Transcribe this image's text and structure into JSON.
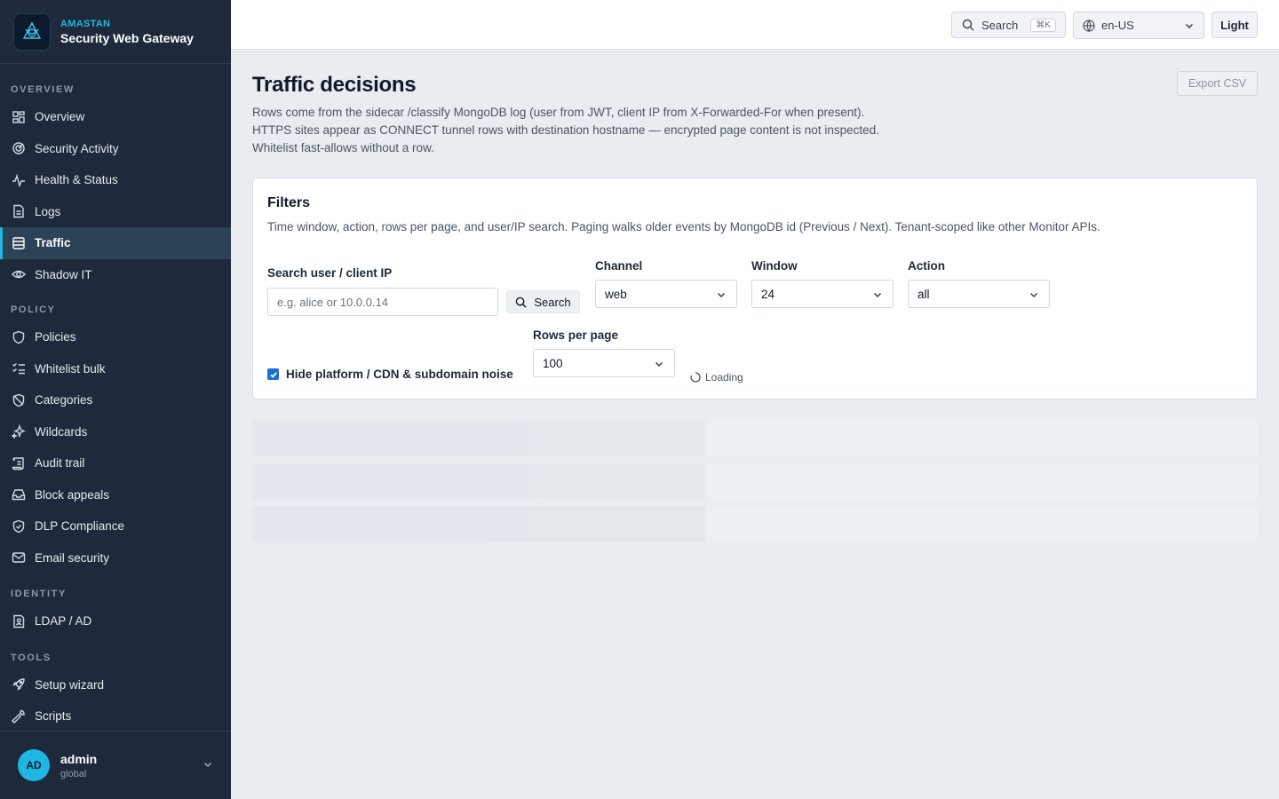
{
  "brand": {
    "company": "AMASTAN",
    "product": "Security Web Gateway"
  },
  "sidebar": {
    "sections": [
      {
        "label": "OVERVIEW",
        "items": [
          {
            "label": "Overview",
            "icon": "grid-icon"
          },
          {
            "label": "Security Activity",
            "icon": "radar-icon"
          },
          {
            "label": "Health & Status",
            "icon": "pulse-icon"
          },
          {
            "label": "Logs",
            "icon": "document-icon"
          },
          {
            "label": "Traffic",
            "icon": "list-icon",
            "active": true
          },
          {
            "label": "Shadow IT",
            "icon": "eye-icon"
          }
        ]
      },
      {
        "label": "POLICY",
        "items": [
          {
            "label": "Policies",
            "icon": "shield-icon"
          },
          {
            "label": "Whitelist bulk",
            "icon": "checklist-icon"
          },
          {
            "label": "Categories",
            "icon": "shield-slash-icon"
          },
          {
            "label": "Wildcards",
            "icon": "sparkles-icon"
          },
          {
            "label": "Audit trail",
            "icon": "scroll-icon"
          },
          {
            "label": "Block appeals",
            "icon": "inbox-icon"
          },
          {
            "label": "DLP Compliance",
            "icon": "shield-check-icon"
          },
          {
            "label": "Email security",
            "icon": "mail-icon"
          }
        ]
      },
      {
        "label": "IDENTITY",
        "items": [
          {
            "label": "LDAP / AD",
            "icon": "contact-book-icon"
          }
        ]
      },
      {
        "label": "TOOLS",
        "items": [
          {
            "label": "Setup wizard",
            "icon": "rocket-icon"
          },
          {
            "label": "Scripts",
            "icon": "wrench-icon"
          }
        ]
      }
    ]
  },
  "user": {
    "initials": "AD",
    "name": "admin",
    "scope": "global"
  },
  "topbar": {
    "search_label": "Search",
    "shortcut": "⌘K",
    "locale": "en-US",
    "theme": "Light"
  },
  "page": {
    "title": "Traffic decisions",
    "export_label": "Export CSV",
    "description": [
      "Rows come from the sidecar /classify MongoDB log (user from JWT, client IP from X-Forwarded-For when present).",
      "HTTPS sites appear as CONNECT tunnel rows with destination hostname — encrypted page content is not inspected.",
      "Whitelist fast-allows without a row."
    ]
  },
  "filters": {
    "title": "Filters",
    "description": "Time window, action, rows per page, and user/IP search. Paging walks older events by MongoDB id (Previous / Next). Tenant-scoped like other Monitor APIs.",
    "search_label": "Search user / client IP",
    "search_placeholder": "e.g. alice or 10.0.0.14",
    "search_button": "Search",
    "channel_label": "Channel",
    "channel_value": "web",
    "window_label": "Window",
    "window_value": "24",
    "action_label": "Action",
    "action_value": "all",
    "rows_label": "Rows per page",
    "rows_value": "100",
    "hide_noise_label": "Hide platform / CDN & subdomain noise",
    "hide_noise_checked": true,
    "loading_text": "Loading"
  },
  "colors": {
    "sidebar_bg": "#1e2a3b",
    "accent": "#1bb8e0",
    "active_bg": "#2b4257",
    "checkbox": "#1b6fd1"
  }
}
